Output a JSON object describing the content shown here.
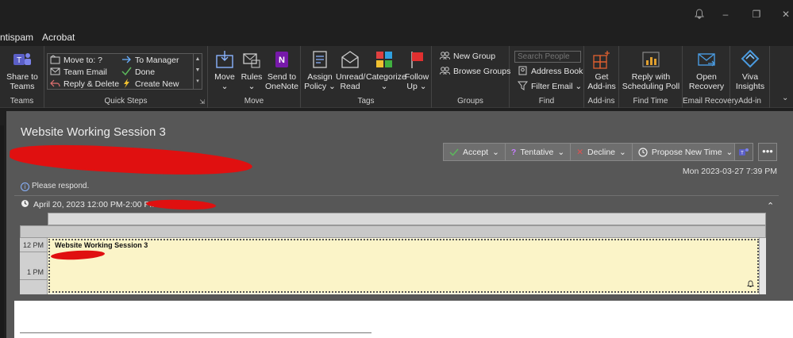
{
  "menu": {
    "items": [
      "ntispam",
      "Acrobat"
    ]
  },
  "ribbon": {
    "teams": {
      "button": [
        "Share to",
        "Teams"
      ],
      "label": "Teams"
    },
    "quick_steps": {
      "items": [
        "Move to: ?",
        "To Manager",
        "Team Email",
        "Done",
        "Reply & Delete",
        "Create New"
      ],
      "label": "Quick Steps"
    },
    "move": {
      "move": "Move",
      "rules": "Rules",
      "onenote": [
        "Send to",
        "OneNote"
      ],
      "label": "Move"
    },
    "tags": {
      "assign": [
        "Assign",
        "Policy"
      ],
      "unread": [
        "Unread/",
        "Read"
      ],
      "categorize": "Categorize",
      "followup": [
        "Follow",
        "Up"
      ],
      "label": "Tags"
    },
    "groups": {
      "new_group": "New Group",
      "browse": "Browse Groups",
      "label": "Groups"
    },
    "find": {
      "search_placeholder": "Search People",
      "address_book": "Address Book",
      "filter": "Filter Email",
      "label": "Find"
    },
    "addins": {
      "get": [
        "Get",
        "Add-ins"
      ],
      "label": "Add-ins"
    },
    "find_time": {
      "reply": [
        "Reply with",
        "Scheduling Poll"
      ],
      "label": "Find Time"
    },
    "email_recovery": {
      "open": [
        "Open",
        "Recovery"
      ],
      "label": "Email Recovery"
    },
    "viva": {
      "insights": [
        "Viva",
        "Insights"
      ],
      "label": "Add-in"
    }
  },
  "message": {
    "subject": "Website Working Session 3",
    "responses": [
      "Accept",
      "Tentative",
      "Decline",
      "Propose New Time"
    ],
    "sent": "Mon 2023-03-27 7:39 PM",
    "notice": "Please respond.",
    "meeting_time": "April 20, 2023 12:00 PM-2:00 PM"
  },
  "calendar": {
    "hours": [
      "12 PM",
      "1 PM"
    ],
    "event_title": "Website Working Session 3"
  },
  "colors": {
    "event_bg": "#fbf4c8",
    "redaction": "#e01010",
    "accept_icon": "#5cb85c",
    "tentative_icon": "#c77dff",
    "decline_icon": "#e05050"
  }
}
